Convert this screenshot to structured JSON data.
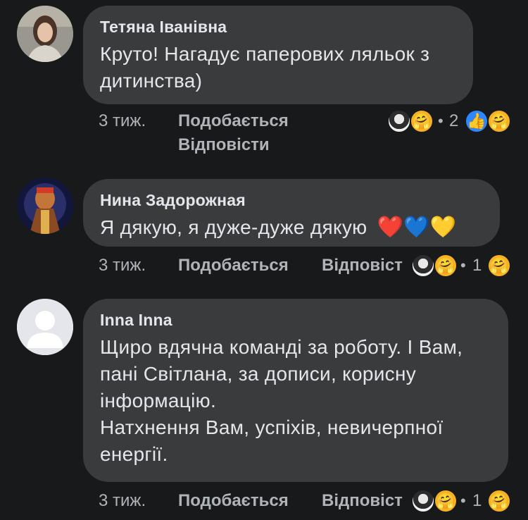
{
  "comments": [
    {
      "author": "Тетяна Іванівна",
      "text": "Круто! Нагадує паперових ляльок з дитинства)",
      "time": "3 тиж.",
      "like_label": "Подобається",
      "reply_label": "Відповісти",
      "reaction_count": "2",
      "reaction_icons": [
        "profile-photo",
        "care-emoji",
        "like-icon",
        "care-emoji"
      ]
    },
    {
      "author": "Нина Задорожная",
      "text": "Я дякую, я дуже-дуже дякую",
      "emojis": "❤️💙💛",
      "time": "3 тиж.",
      "like_label": "Подобається",
      "reply_label": "Відповіст",
      "reaction_count": "1",
      "reaction_icons": [
        "profile-photo",
        "care-emoji",
        "care-emoji"
      ]
    },
    {
      "author": "Inna Inna",
      "text_lines": [
        "Щиро вдячна команді за роботу. І Вам,",
        "пані Світлана, за дописи, корисну",
        "інформацію.",
        "Натхнення Вам, успіхів, невичерпної",
        "енергії."
      ],
      "time": "3 тиж.",
      "like_label": "Подобається",
      "reply_label": "Відповіст",
      "reaction_count": "1",
      "reaction_icons": [
        "profile-photo",
        "care-emoji",
        "care-emoji"
      ]
    }
  ],
  "colors": {
    "background": "#18191a",
    "bubble": "#3a3b3c",
    "text": "#e4e6eb",
    "meta": "#b0b3b8",
    "like_blue": "#2d88ff",
    "care_yellow": "#f7b125"
  }
}
